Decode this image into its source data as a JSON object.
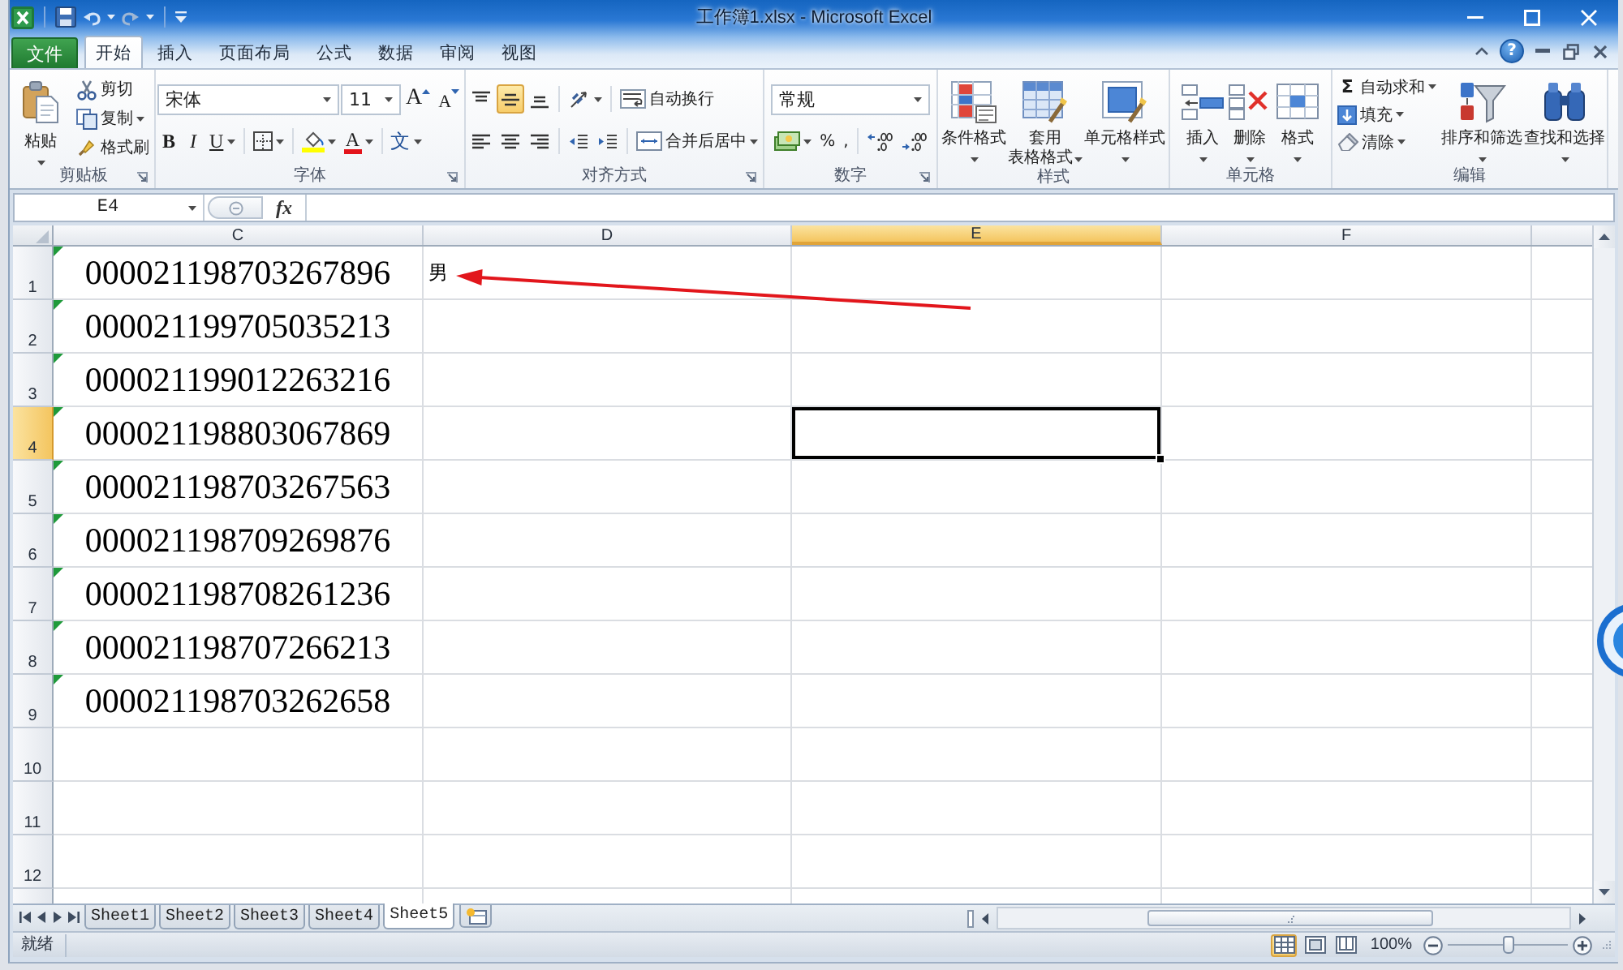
{
  "window": {
    "title": "工作簿1.xlsx - Microsoft Excel"
  },
  "ribbon": {
    "file_tab": "文件",
    "help_glyph": "?",
    "tabs": [
      {
        "label": "开始",
        "selected": true
      },
      {
        "label": "插入",
        "selected": false
      },
      {
        "label": "页面布局",
        "selected": false
      },
      {
        "label": "公式",
        "selected": false
      },
      {
        "label": "数据",
        "selected": false
      },
      {
        "label": "审阅",
        "selected": false
      },
      {
        "label": "视图",
        "selected": false
      }
    ],
    "groups": [
      {
        "kind": "clipboard",
        "label": "剪贴板",
        "launcher": true,
        "paste": "粘贴",
        "cut": "剪切",
        "copy": "复制",
        "format_painter": "格式刷"
      },
      {
        "kind": "font",
        "label": "字体",
        "launcher": true,
        "font_name": "宋体",
        "font_size": "11",
        "grow_glyph": "A",
        "shrink_glyph": "A",
        "bold": "B",
        "italic": "I",
        "underline": "U",
        "font_color_glyph": "A",
        "phonetic_glyph": "文"
      },
      {
        "kind": "alignment",
        "label": "对齐方式",
        "launcher": true,
        "vertical_align": [
          {
            "kind": "top",
            "selected": false
          },
          {
            "kind": "middle",
            "selected": true
          },
          {
            "kind": "bottom",
            "selected": false
          }
        ],
        "horizontal_align": [
          {
            "kind": "left",
            "selected": false
          },
          {
            "kind": "center",
            "selected": false
          },
          {
            "kind": "right",
            "selected": false
          }
        ],
        "wrap_text": "自动换行",
        "merge_center": "合并后居中"
      },
      {
        "kind": "number",
        "label": "数字",
        "launcher": true,
        "format": "常规",
        "percent": "%",
        "comma": ","
      },
      {
        "kind": "styles",
        "label": "样式",
        "launcher": false,
        "buttons": [
          {
            "kind": "conditional",
            "lines": [
              "条件格式"
            ]
          },
          {
            "kind": "table",
            "lines": [
              "套用",
              "表格格式"
            ]
          },
          {
            "kind": "cell",
            "lines": [
              "单元格样式"
            ]
          }
        ]
      },
      {
        "kind": "cells",
        "label": "单元格",
        "launcher": false,
        "buttons": [
          {
            "kind": "insert",
            "lines": [
              "插入"
            ]
          },
          {
            "kind": "delete",
            "lines": [
              "删除"
            ]
          },
          {
            "kind": "format",
            "lines": [
              "格式"
            ]
          }
        ]
      },
      {
        "kind": "editing",
        "label": "编辑",
        "launcher": false,
        "autosum_glyph": "Σ",
        "autosum": "自动求和",
        "fill": "填充",
        "clear": "清除",
        "buttons": [
          {
            "kind": "sort",
            "lines": [
              "排序和筛选"
            ]
          },
          {
            "kind": "find",
            "lines": [
              "查找和选择"
            ]
          }
        ]
      }
    ]
  },
  "formula_bar": {
    "name_box": "E4",
    "fx": "fx"
  },
  "sheet": {
    "columns": [
      {
        "label": "C",
        "selected": false
      },
      {
        "label": "D",
        "selected": false
      },
      {
        "label": "E",
        "selected": true
      },
      {
        "label": "F",
        "selected": false
      }
    ],
    "rows": [
      {
        "header": "1",
        "selected": false,
        "flagged": true,
        "cells": [
          "000021198703267896",
          "男"
        ]
      },
      {
        "header": "2",
        "selected": false,
        "flagged": true,
        "cells": [
          "000021199705035213"
        ]
      },
      {
        "header": "3",
        "selected": false,
        "flagged": true,
        "cells": [
          "000021199012263216"
        ]
      },
      {
        "header": "4",
        "selected": true,
        "flagged": true,
        "cells": [
          "000021198803067869"
        ]
      },
      {
        "header": "5",
        "selected": false,
        "flagged": true,
        "cells": [
          "000021198703267563"
        ]
      },
      {
        "header": "6",
        "selected": false,
        "flagged": true,
        "cells": [
          "000021198709269876"
        ]
      },
      {
        "header": "7",
        "selected": false,
        "flagged": true,
        "cells": [
          "000021198708261236"
        ]
      },
      {
        "header": "8",
        "selected": false,
        "flagged": true,
        "cells": [
          "000021198707266213"
        ]
      },
      {
        "header": "9",
        "selected": false,
        "flagged": true,
        "cells": [
          "000021198703262658"
        ]
      },
      {
        "header": "10",
        "selected": false,
        "flagged": false
      },
      {
        "header": "11",
        "selected": false,
        "flagged": false
      },
      {
        "header": "12",
        "selected": false,
        "flagged": false
      }
    ]
  },
  "sheet_tabs": [
    {
      "label": "Sheet1",
      "selected": false
    },
    {
      "label": "Sheet2",
      "selected": false
    },
    {
      "label": "Sheet3",
      "selected": false
    },
    {
      "label": "Sheet4",
      "selected": false
    },
    {
      "label": "Sheet5",
      "selected": true
    }
  ],
  "status_bar": {
    "status": "就绪",
    "views": [
      {
        "kind": "normal",
        "selected": true
      },
      {
        "kind": "page_layout",
        "selected": false
      },
      {
        "kind": "page_break",
        "selected": false
      }
    ],
    "zoom": "100%",
    "zoom_slider": {
      "level": 0.5
    }
  }
}
